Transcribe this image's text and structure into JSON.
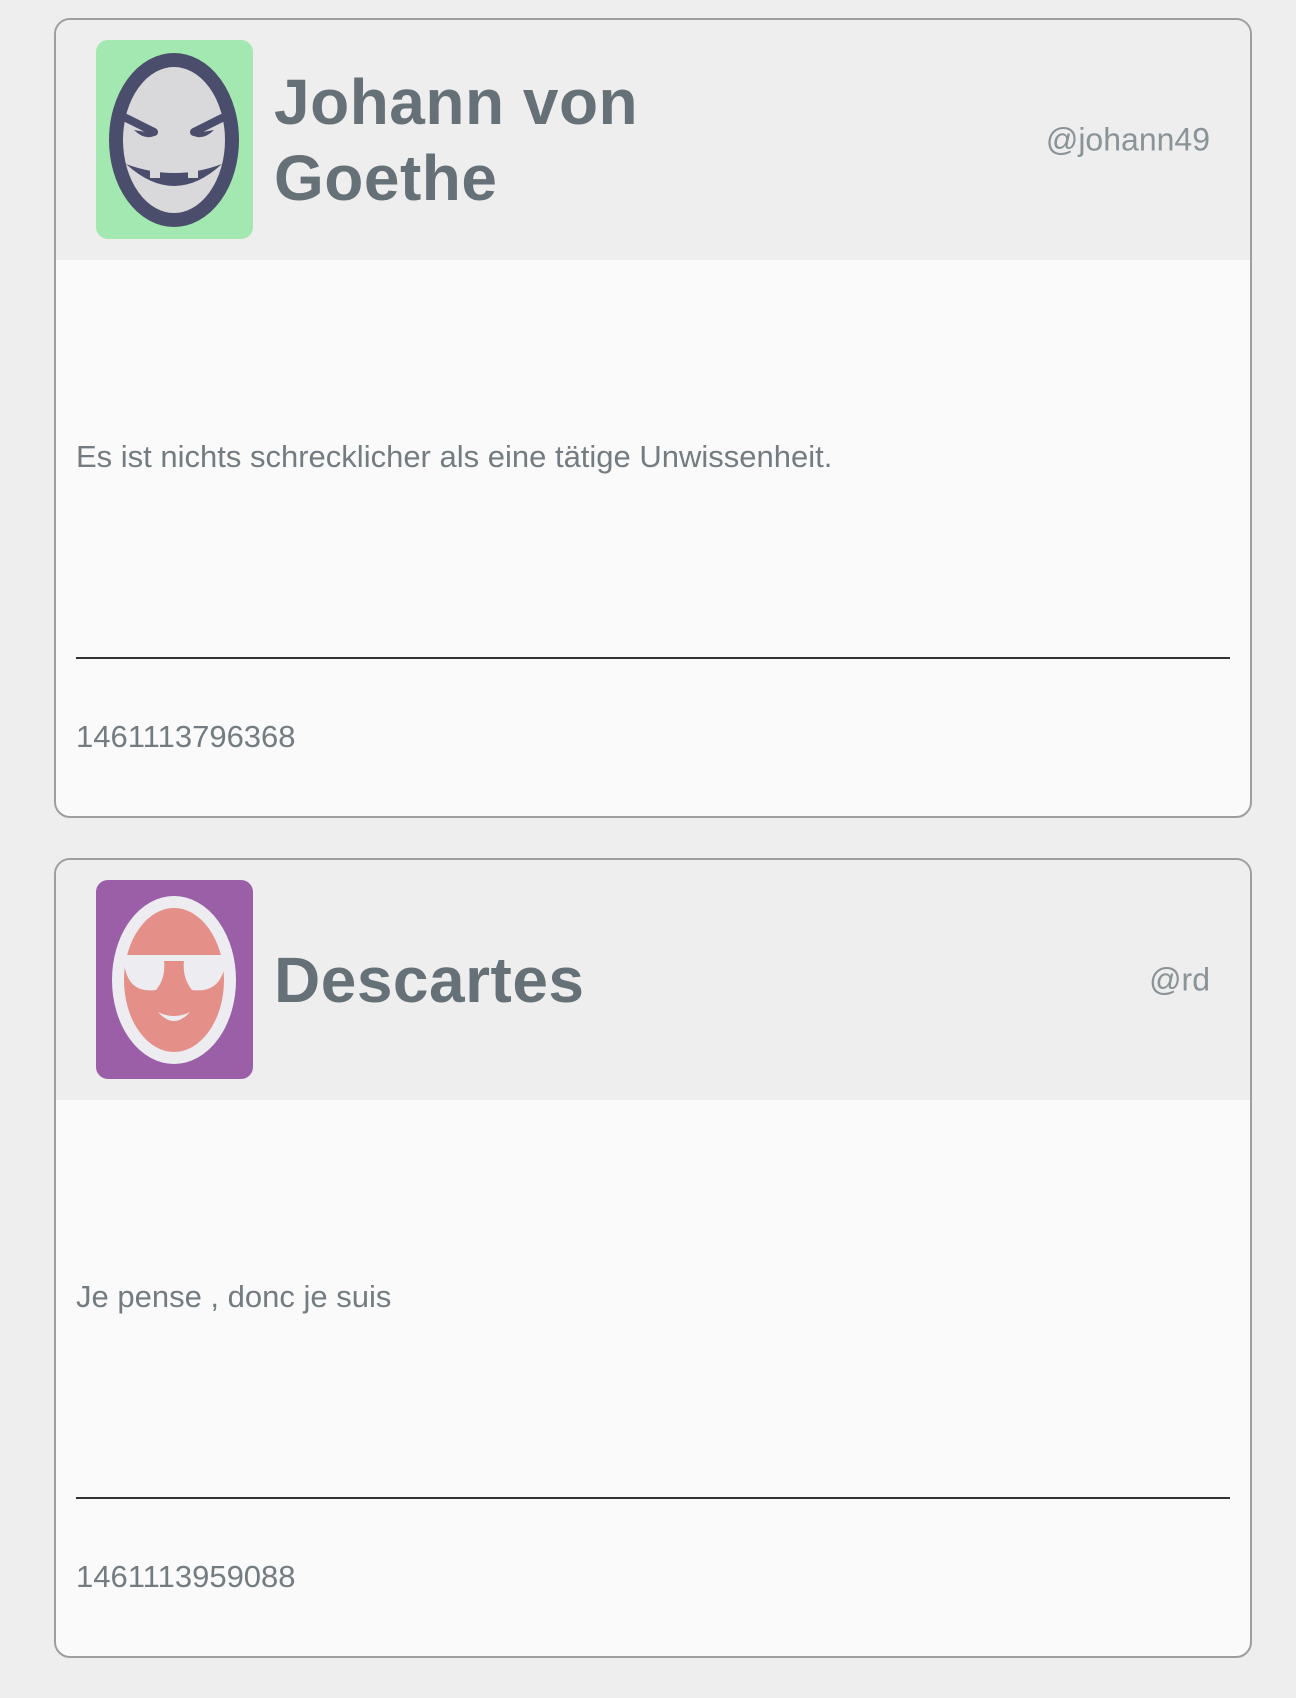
{
  "tweets": [
    {
      "display_name": "Johann von Goethe",
      "handle": "@johann49",
      "text": "Es ist nichts schrecklicher als eine tätige Unwissenheit.",
      "timestamp": "1461113796368",
      "avatar": {
        "icon": "evil-grin-face-icon",
        "background_color": "#a3e8b0",
        "face_color": "#d9d9dc",
        "outline_color": "#4a4d6b"
      }
    },
    {
      "display_name": "Descartes",
      "handle": "@rd",
      "text": "Je pense , donc je suis",
      "timestamp": "1461113959088",
      "avatar": {
        "icon": "sunglasses-face-icon",
        "background_color": "#9b5fa8",
        "face_color": "#e49089",
        "outline_color": "#ececf1"
      }
    }
  ]
}
